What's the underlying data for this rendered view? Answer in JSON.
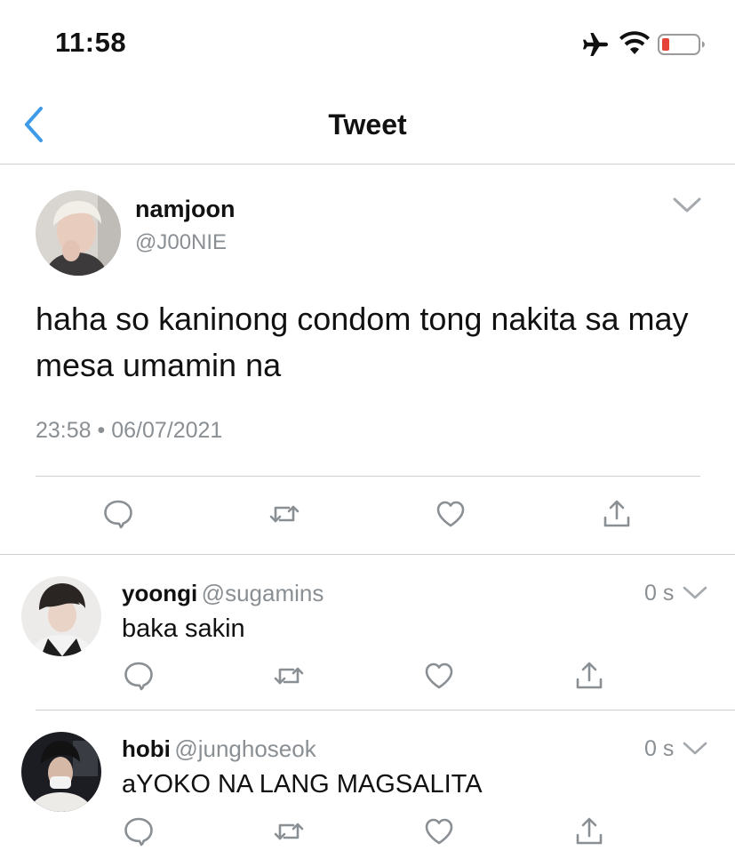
{
  "status_bar": {
    "time": "11:58",
    "icons": [
      "airplane-icon",
      "wifi-icon",
      "battery-low-icon"
    ],
    "battery_color": "#e5443a"
  },
  "nav": {
    "title": "Tweet",
    "back_icon": "chevron-left-icon",
    "accent_color": "#3d9be9"
  },
  "main_tweet": {
    "name": "namjoon",
    "handle": "@J00NIE",
    "text": "haha so kaninong condom tong nakita sa may mesa umamin na",
    "timestamp": "23:58 • 06/07/2021",
    "actions": [
      "reply-icon",
      "retweet-icon",
      "like-icon",
      "share-icon"
    ]
  },
  "replies": [
    {
      "name": "yoongi",
      "handle": "@sugamins",
      "time": "0 s",
      "text": "baka sakin"
    },
    {
      "name": "hobi",
      "handle": "@junghoseok",
      "time": "0 s",
      "text": "aYOKO NA LANG MAGSALITA"
    }
  ]
}
